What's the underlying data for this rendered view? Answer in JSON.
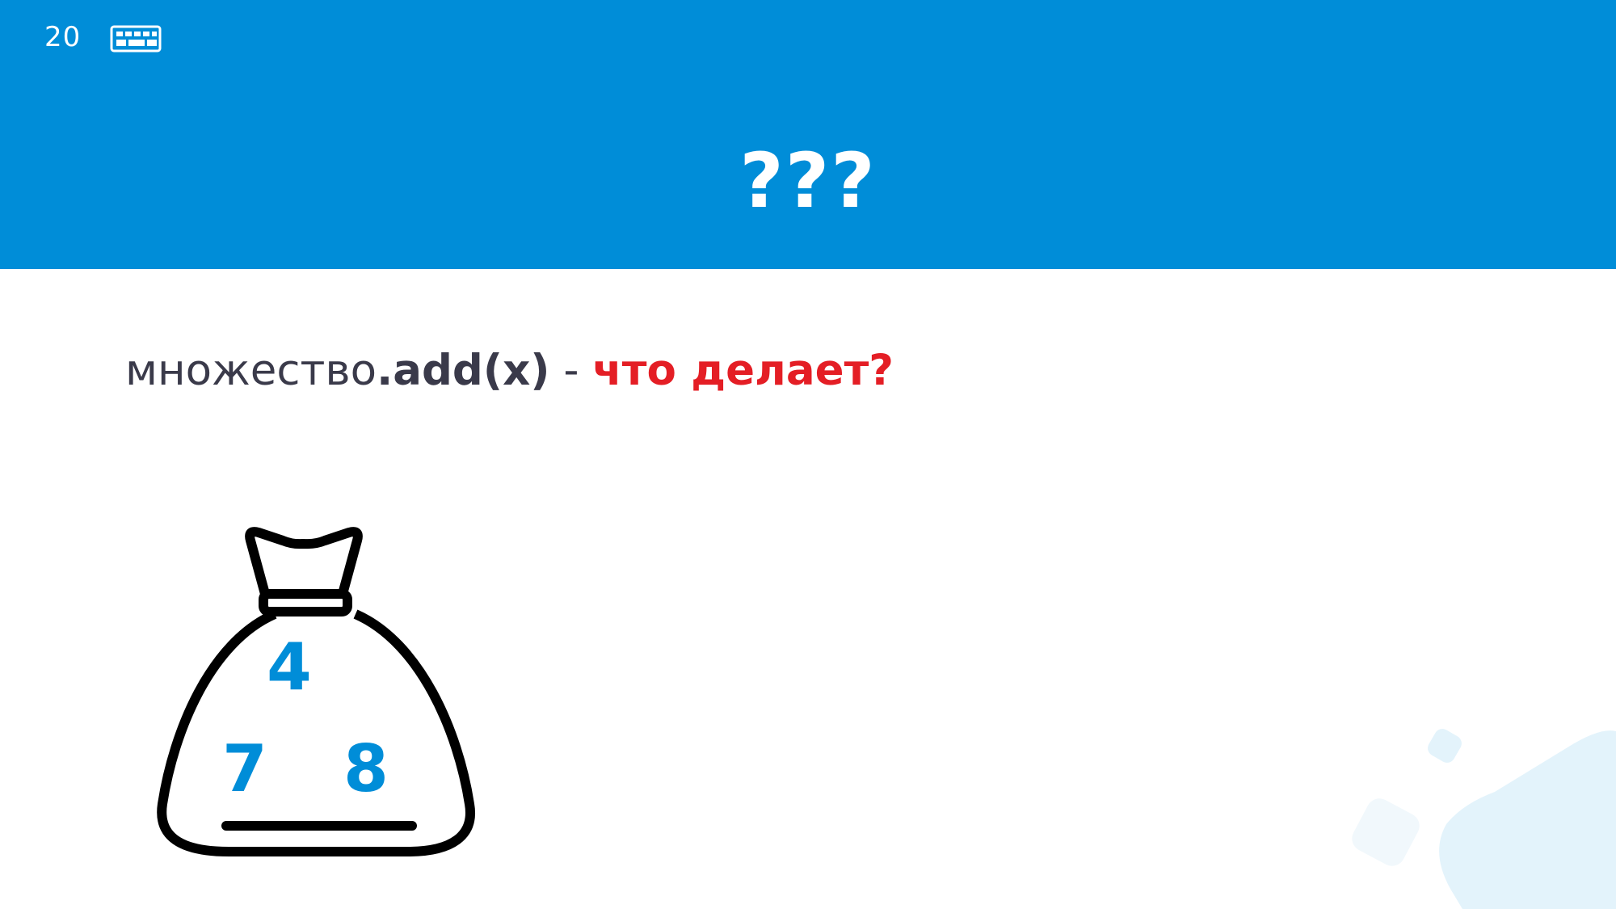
{
  "slide": {
    "number": "20"
  },
  "header": {
    "title": "???"
  },
  "statement": {
    "object": "множество",
    "method": ".add(x)",
    "separator": " - ",
    "question": "что делает?"
  },
  "bag": {
    "numbers": [
      "4",
      "7",
      "8"
    ]
  },
  "colors": {
    "header_bg": "#008dd8",
    "accent_red": "#e41e25",
    "number_blue": "#008dd8",
    "decor_light": "#e3f3fb"
  },
  "icons": [
    "keyboard-icon",
    "bag-icon"
  ]
}
